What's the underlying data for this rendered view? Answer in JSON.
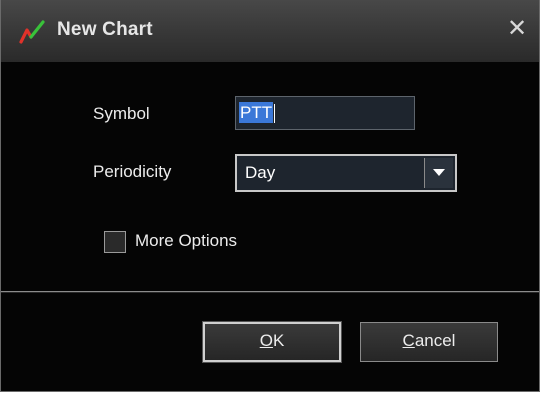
{
  "window": {
    "title": "New Chart",
    "app_icon": "chart-line-icon",
    "close_glyph": "✕"
  },
  "form": {
    "symbol_label": "Symbol",
    "symbol_value": "PTT",
    "periodicity_label": "Periodicity",
    "periodicity_value": "Day",
    "more_options_label": "More Options",
    "more_options_checked": false
  },
  "buttons": {
    "ok_mnemonic": "O",
    "ok_rest": "K",
    "cancel_mnemonic": "C",
    "cancel_rest": "ancel"
  },
  "colors": {
    "background": "#050505",
    "titlebar": "#3a3a3a",
    "selection": "#3b78d8",
    "icon_red": "#e0322a",
    "icon_green": "#39c23a"
  }
}
